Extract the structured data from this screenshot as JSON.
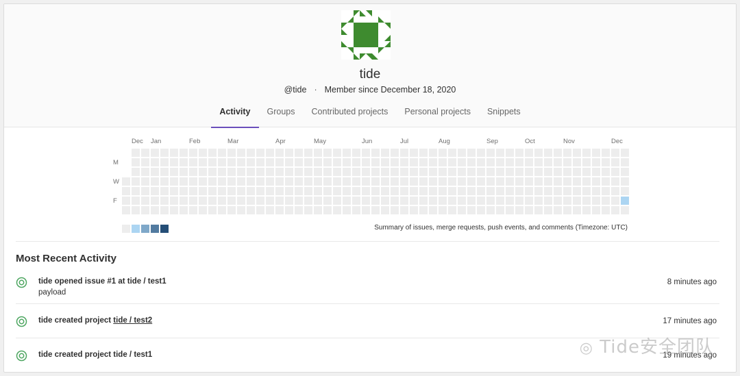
{
  "profile": {
    "name": "tide",
    "handle": "@tide",
    "member_since": "Member since December 18, 2020",
    "avatar_color": "#3e8b2f"
  },
  "tabs": [
    {
      "label": "Activity",
      "active": true
    },
    {
      "label": "Groups",
      "active": false
    },
    {
      "label": "Contributed projects",
      "active": false
    },
    {
      "label": "Personal projects",
      "active": false
    },
    {
      "label": "Snippets",
      "active": false
    }
  ],
  "calendar": {
    "months": [
      "Dec",
      "Jan",
      "Feb",
      "Mar",
      "Apr",
      "May",
      "Jun",
      "Jul",
      "Aug",
      "Sep",
      "Oct",
      "Nov",
      "Dec"
    ],
    "day_labels": [
      "M",
      "W",
      "F"
    ],
    "summary": "Summary of issues, merge requests, push events, and comments (Timezone: UTC)",
    "legend_colors": [
      "#ededed",
      "#acd5f2",
      "#7fa8c9",
      "#527ba0",
      "#254e77"
    ],
    "active_day": {
      "week": 52,
      "day": 5,
      "level": 1
    }
  },
  "recent_activity": {
    "title": "Most Recent Activity",
    "items": [
      {
        "text": "tide opened issue #1 at tide / test1",
        "sub": "payload",
        "time": "8 minutes ago"
      },
      {
        "text_prefix": "tide created project ",
        "link": "tide / test2",
        "time": "17 minutes ago"
      },
      {
        "text": "tide created project tide / test1",
        "time": "19 minutes ago"
      }
    ]
  },
  "watermark": "Tide安全团队",
  "colors": {
    "accent": "#6b4fbb",
    "event_icon": "#4ea661"
  }
}
